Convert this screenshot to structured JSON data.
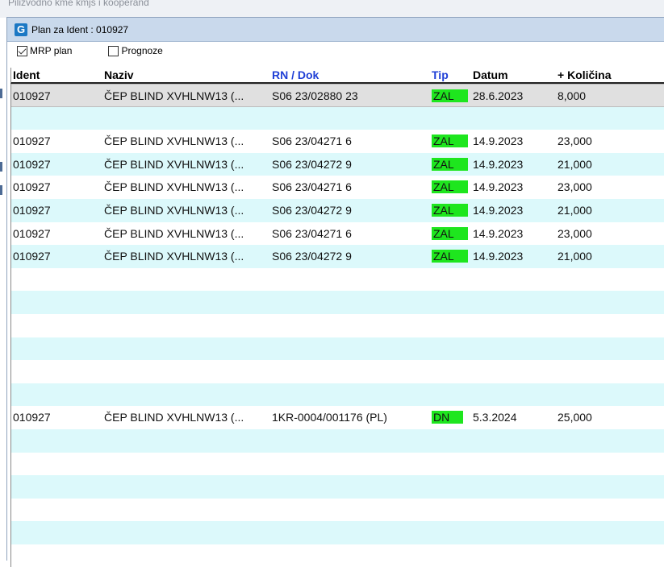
{
  "background_window": {
    "partial_title": "Pilizvodno kme kmjs i kooperand"
  },
  "window": {
    "icon_letter": "G",
    "title": "Plan za  Ident : 010927"
  },
  "filters": {
    "mrp_label": "MRP plan",
    "mrp_checked": true,
    "prognoze_label": "Prognoze",
    "prognoze_checked": false
  },
  "table": {
    "headers": {
      "ident": "Ident",
      "naziv": "Naziv",
      "rn_dok": "RN / Dok",
      "tip": "Tip",
      "datum": "Datum",
      "kolicina": "+ Količina"
    },
    "tip_color": "#1ee61e",
    "rows": [
      {
        "ident": "010927",
        "naziv": "ČEP BLIND XVHLNW13 (...",
        "rn": "S06 23/02880 23",
        "tip": "ZAL",
        "datum": "28.6.2023",
        "kolicina": "8,000"
      },
      {
        "ident": "",
        "naziv": "",
        "rn": "",
        "tip": "",
        "datum": "",
        "kolicina": ""
      },
      {
        "ident": "010927",
        "naziv": "ČEP BLIND XVHLNW13 (...",
        "rn": "S06 23/04271 6",
        "tip": "ZAL",
        "datum": "14.9.2023",
        "kolicina": "23,000"
      },
      {
        "ident": "010927",
        "naziv": "ČEP BLIND XVHLNW13 (...",
        "rn": "S06 23/04272 9",
        "tip": "ZAL",
        "datum": "14.9.2023",
        "kolicina": "21,000"
      },
      {
        "ident": "010927",
        "naziv": "ČEP BLIND XVHLNW13 (...",
        "rn": "S06 23/04271 6",
        "tip": "ZAL",
        "datum": "14.9.2023",
        "kolicina": "23,000"
      },
      {
        "ident": "010927",
        "naziv": "ČEP BLIND XVHLNW13 (...",
        "rn": "S06 23/04272 9",
        "tip": "ZAL",
        "datum": "14.9.2023",
        "kolicina": "21,000"
      },
      {
        "ident": "010927",
        "naziv": "ČEP BLIND XVHLNW13 (...",
        "rn": "S06 23/04271 6",
        "tip": "ZAL",
        "datum": "14.9.2023",
        "kolicina": "23,000"
      },
      {
        "ident": "010927",
        "naziv": "ČEP BLIND XVHLNW13 (...",
        "rn": "S06 23/04272 9",
        "tip": "ZAL",
        "datum": "14.9.2023",
        "kolicina": "21,000"
      },
      {
        "ident": "",
        "naziv": "",
        "rn": "",
        "tip": "",
        "datum": "",
        "kolicina": ""
      },
      {
        "ident": "",
        "naziv": "",
        "rn": "",
        "tip": "",
        "datum": "",
        "kolicina": ""
      },
      {
        "ident": "",
        "naziv": "",
        "rn": "",
        "tip": "",
        "datum": "",
        "kolicina": ""
      },
      {
        "ident": "",
        "naziv": "",
        "rn": "",
        "tip": "",
        "datum": "",
        "kolicina": ""
      },
      {
        "ident": "",
        "naziv": "",
        "rn": "",
        "tip": "",
        "datum": "",
        "kolicina": ""
      },
      {
        "ident": "",
        "naziv": "",
        "rn": "",
        "tip": "",
        "datum": "",
        "kolicina": ""
      },
      {
        "ident": "010927",
        "naziv": "ČEP BLIND XVHLNW13 (...",
        "rn": "1KR-0004/001176 (PL)",
        "tip": "DN",
        "datum": "5.3.2024",
        "kolicina": "25,000"
      },
      {
        "ident": "",
        "naziv": "",
        "rn": "",
        "tip": "",
        "datum": "",
        "kolicina": ""
      },
      {
        "ident": "",
        "naziv": "",
        "rn": "",
        "tip": "",
        "datum": "",
        "kolicina": ""
      },
      {
        "ident": "",
        "naziv": "",
        "rn": "",
        "tip": "",
        "datum": "",
        "kolicina": ""
      },
      {
        "ident": "",
        "naziv": "",
        "rn": "",
        "tip": "",
        "datum": "",
        "kolicina": ""
      },
      {
        "ident": "",
        "naziv": "",
        "rn": "",
        "tip": "",
        "datum": "",
        "kolicina": ""
      },
      {
        "ident": "",
        "naziv": "",
        "rn": "",
        "tip": "",
        "datum": "",
        "kolicina": ""
      }
    ]
  }
}
